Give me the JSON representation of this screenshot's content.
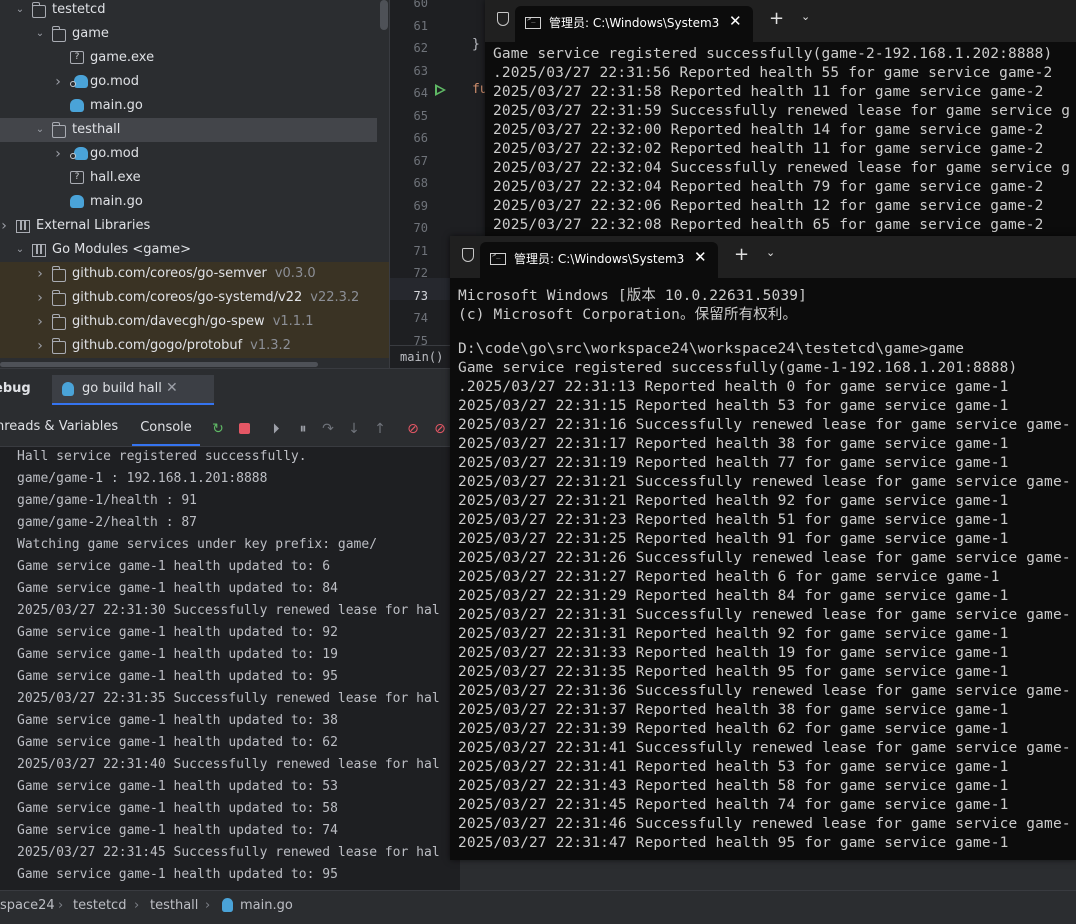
{
  "project_tree": {
    "rows": [
      {
        "label": "testetcd",
        "kind": "folder",
        "expanded": true,
        "level": 1
      },
      {
        "label": "game",
        "kind": "folder",
        "expanded": true,
        "level": 2
      },
      {
        "label": "game.exe",
        "kind": "unknown-file",
        "level": 3
      },
      {
        "label": "go.mod",
        "kind": "gomod",
        "collapsed": true,
        "level": 3
      },
      {
        "label": "main.go",
        "kind": "gofile",
        "level": 3
      },
      {
        "label": "testhall",
        "kind": "folder",
        "expanded": true,
        "level": 2,
        "selected": true
      },
      {
        "label": "go.mod",
        "kind": "gomod",
        "collapsed": true,
        "level": 3
      },
      {
        "label": "hall.exe",
        "kind": "unknown-file",
        "level": 3
      },
      {
        "label": "main.go",
        "kind": "gofile",
        "level": 3
      },
      {
        "label": "External Libraries",
        "kind": "library",
        "collapsed": true,
        "level": 0
      },
      {
        "label": "Go Modules <game>",
        "kind": "library",
        "expanded": true,
        "level": 1
      },
      {
        "label": "github.com/coreos/go-semver",
        "version": "v0.3.0",
        "kind": "folder",
        "collapsed": true,
        "level": 2,
        "lib": true
      },
      {
        "label": "github.com/coreos/go-systemd/v22",
        "version": "v22.3.2",
        "kind": "folder",
        "collapsed": true,
        "level": 2,
        "lib": true
      },
      {
        "label": "github.com/davecgh/go-spew",
        "version": "v1.1.1",
        "kind": "folder",
        "collapsed": true,
        "level": 2,
        "lib": true
      },
      {
        "label": "github.com/gogo/protobuf",
        "version": "v1.3.2",
        "kind": "folder",
        "collapsed": true,
        "level": 2,
        "lib": true
      }
    ]
  },
  "editor": {
    "line_numbers": [
      "60",
      "61",
      "62",
      "63",
      "64",
      "65",
      "66",
      "67",
      "68",
      "69",
      "70",
      "71",
      "72",
      "73",
      "74",
      "75"
    ],
    "current_line": "73",
    "code_brace": "}",
    "code_keyword_partial": "fu",
    "breadcrumb": "main()"
  },
  "debug": {
    "title": "ebug",
    "run_tab_label": "go build hall",
    "tabs": {
      "threads": "hreads & Variables",
      "console": "Console"
    },
    "console_lines": [
      "Hall service registered successfully.",
      "game/game-1 : 192.168.1.201:8888",
      "game/game-1/health : 91",
      "game/game-2/health : 87",
      "Watching game services under key prefix: game/",
      "Game service game-1 health updated to: 6",
      "Game service game-1 health updated to: 84",
      "2025/03/27 22:31:30 Successfully renewed lease for hal",
      "Game service game-1 health updated to: 92",
      "Game service game-1 health updated to: 19",
      "Game service game-1 health updated to: 95",
      "2025/03/27 22:31:35 Successfully renewed lease for hal",
      "Game service game-1 health updated to: 38",
      "Game service game-1 health updated to: 62",
      "2025/03/27 22:31:40 Successfully renewed lease for hal",
      "Game service game-1 health updated to: 53",
      "Game service game-1 health updated to: 58",
      "Game service game-1 health updated to: 74",
      "2025/03/27 22:31:45 Successfully renewed lease for hal",
      "Game service game-1 health updated to: 95"
    ]
  },
  "status_bar": {
    "crumbs": [
      "space24",
      "testetcd",
      "testhall",
      "main.go"
    ]
  },
  "terminal_top": {
    "tab_title": "管理员: C:\\Windows\\System3",
    "lines": [
      "Game service registered successfully(game-2-192.168.1.202:8888)",
      ".2025/03/27 22:31:56 Reported health 55 for game service game-2",
      "2025/03/27 22:31:58 Reported health 11 for game service game-2",
      "2025/03/27 22:31:59 Successfully renewed lease for game service g",
      "2025/03/27 22:32:00 Reported health 14 for game service game-2",
      "2025/03/27 22:32:02 Reported health 11 for game service game-2",
      "2025/03/27 22:32:04 Successfully renewed lease for game service g",
      "2025/03/27 22:32:04 Reported health 79 for game service game-2",
      "2025/03/27 22:32:06 Reported health 12 for game service game-2",
      "2025/03/27 22:32:08 Reported health 65 for game service game-2"
    ]
  },
  "terminal_bottom": {
    "tab_title": "管理员: C:\\Windows\\System3",
    "lines": [
      "Microsoft Windows [版本 10.0.22631.5039]",
      "(c) Microsoft Corporation。保留所有权利。",
      "",
      "D:\\code\\go\\src\\workspace24\\workspace24\\testetcd\\game>game",
      "Game service registered successfully(game-1-192.168.1.201:8888)",
      ".2025/03/27 22:31:13 Reported health 0 for game service game-1",
      "2025/03/27 22:31:15 Reported health 53 for game service game-1",
      "2025/03/27 22:31:16 Successfully renewed lease for game service game-",
      "2025/03/27 22:31:17 Reported health 38 for game service game-1",
      "2025/03/27 22:31:19 Reported health 77 for game service game-1",
      "2025/03/27 22:31:21 Successfully renewed lease for game service game-",
      "2025/03/27 22:31:21 Reported health 92 for game service game-1",
      "2025/03/27 22:31:23 Reported health 51 for game service game-1",
      "2025/03/27 22:31:25 Reported health 91 for game service game-1",
      "2025/03/27 22:31:26 Successfully renewed lease for game service game-",
      "2025/03/27 22:31:27 Reported health 6 for game service game-1",
      "2025/03/27 22:31:29 Reported health 84 for game service game-1",
      "2025/03/27 22:31:31 Successfully renewed lease for game service game-",
      "2025/03/27 22:31:31 Reported health 92 for game service game-1",
      "2025/03/27 22:31:33 Reported health 19 for game service game-1",
      "2025/03/27 22:31:35 Reported health 95 for game service game-1",
      "2025/03/27 22:31:36 Successfully renewed lease for game service game-",
      "2025/03/27 22:31:37 Reported health 38 for game service game-1",
      "2025/03/27 22:31:39 Reported health 62 for game service game-1",
      "2025/03/27 22:31:41 Successfully renewed lease for game service game-",
      "2025/03/27 22:31:41 Reported health 53 for game service game-1",
      "2025/03/27 22:31:43 Reported health 58 for game service game-1",
      "2025/03/27 22:31:45 Reported health 74 for game service game-1",
      "2025/03/27 22:31:46 Successfully renewed lease for game service game-",
      "2025/03/27 22:31:47 Reported health 95 for game service game-1"
    ]
  },
  "colors": {
    "ide_bg": "#2b2d30",
    "editor_bg": "#1e1f22",
    "accent": "#3574f0",
    "go_blue": "#4aa3d8",
    "run_green": "#5fb865",
    "stop_red": "#e55765",
    "terminal_bg": "#0c0c0c"
  }
}
